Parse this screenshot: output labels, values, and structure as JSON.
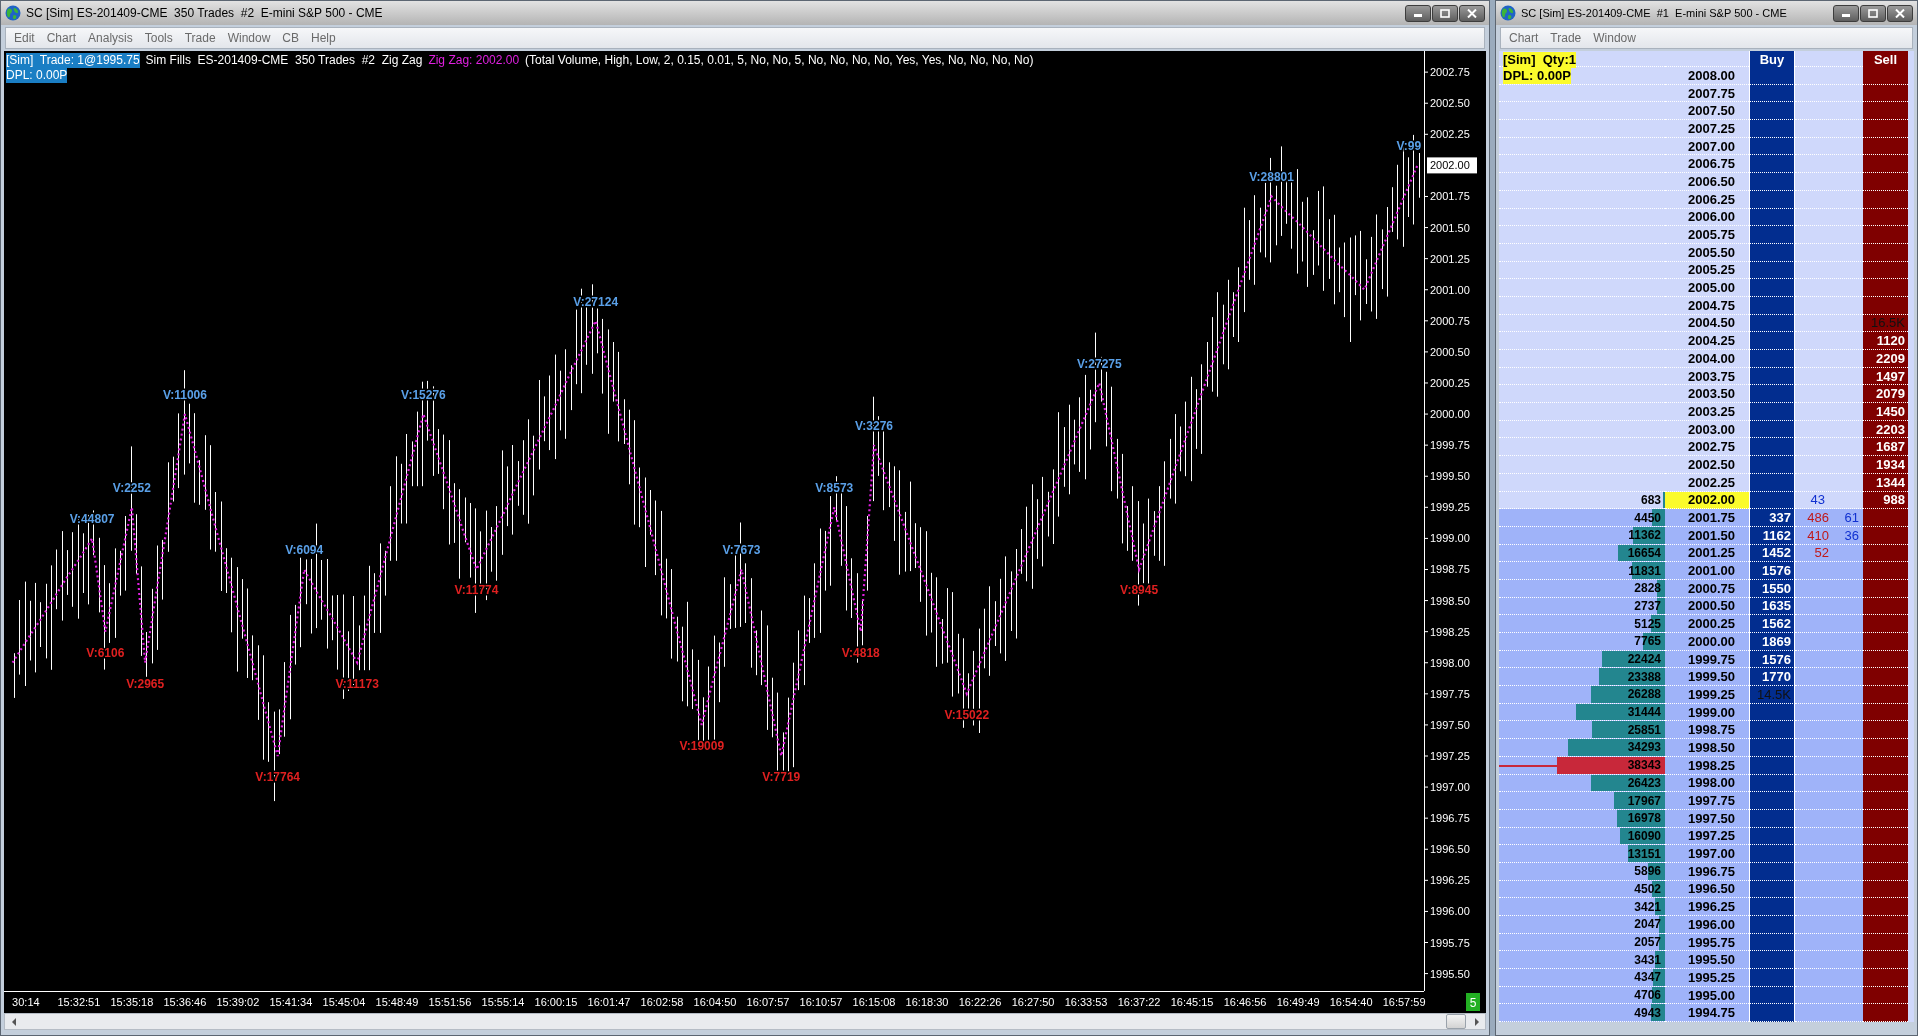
{
  "chart_window": {
    "title": "SC [Sim] ES-201409-CME  350 Trades  #2  E-mini S&P 500 - CME",
    "menu": [
      "Edit",
      "Chart",
      "Analysis",
      "Tools",
      "Trade",
      "Window",
      "CB",
      "Help"
    ],
    "chart": {
      "header": [
        {
          "text": "[Sim]  Trade: 1@1995.75",
          "kind": "badge"
        },
        {
          "text": "Sim Fills  ES-201409-CME  350 Trades  #2  Zig Zag",
          "kind": "plain"
        },
        {
          "text": "Zig Zag: 2002.00",
          "kind": "study"
        },
        {
          "text": "(Total Volume, High, Low, 2, 0.15, 0.01, 5, No, No, 5, No, No, No, No, Yes, Yes, No, No, No, No)",
          "kind": "plain"
        }
      ],
      "dpl": "DPL: 0.00P",
      "badge": "5",
      "last_price": "2002.00",
      "chart_data": {
        "type": "line",
        "ylim": [
          1995.36,
          2002.92
        ],
        "categories": [
          null,
          "30:14",
          null,
          null,
          null,
          "15:32:51",
          null,
          null,
          null,
          "15:35:18",
          null,
          null,
          null,
          "15:36:46",
          null,
          null,
          null,
          "15:39:02",
          null,
          null,
          null,
          "15:41:34",
          null,
          null,
          null,
          "15:45:04",
          null,
          null,
          null,
          "15:48:49",
          null,
          null,
          null,
          "15:51:56",
          null,
          null,
          null,
          "15:55:14",
          null,
          null,
          null,
          "16:00:15",
          null,
          null,
          null,
          "16:01:47",
          null,
          null,
          null,
          "16:02:58",
          null,
          null,
          null,
          "16:04:50",
          null,
          null,
          null,
          "16:07:57",
          null,
          null,
          null,
          "16:10:57",
          null,
          null,
          null,
          "16:15:08",
          null,
          null,
          null,
          "16:18:30",
          null,
          null,
          null,
          "16:22:26",
          null,
          null,
          null,
          "16:27:50",
          null,
          null,
          null,
          "16:33:53",
          null,
          null,
          null,
          "16:37:22",
          null,
          null,
          null,
          "16:45:15",
          null,
          null,
          null,
          "16:46:56",
          null,
          null,
          null,
          "16:49:49",
          null,
          null,
          null,
          "16:54:40",
          null,
          null,
          null,
          "16:57:59",
          null
        ],
        "series": [
          {
            "color": "#e020e0",
            "line_style": "dotted",
            "values": [
              1998.0,
              1998.17,
              1998.33,
              1998.5,
              1998.67,
              1998.83,
              1999.0,
              1998.25,
              1998.75,
              1999.25,
              1998.0,
              1998.67,
              1999.33,
              2000.0,
              1999.61,
              1999.21,
              1998.82,
              1998.43,
              1998.04,
              1997.64,
              1997.25,
              1998.0,
              1998.75,
              1998.56,
              1998.38,
              1998.19,
              1998.0,
              1998.4,
              1998.8,
              1999.2,
              1999.6,
              2000.0,
              1999.69,
              1999.38,
              1999.06,
              1998.75,
              1998.97,
              1999.19,
              1999.42,
              1999.64,
              1999.86,
              2000.08,
              2000.31,
              2000.53,
              2000.75,
              2000.34,
              1999.94,
              1999.53,
              1999.13,
              1998.72,
              1998.31,
              1997.91,
              1997.5,
              1997.92,
              1998.33,
              1998.75,
              1998.25,
              1997.75,
              1997.25,
              1997.75,
              1998.25,
              1998.75,
              1999.25,
              1998.75,
              1998.25,
              1999.75,
              1999.46,
              1999.18,
              1998.89,
              1998.61,
              1998.32,
              1998.04,
              1997.75,
              1998.0,
              1998.25,
              1998.5,
              1998.75,
              1999.0,
              1999.25,
              1999.5,
              1999.75,
              2000.0,
              2000.25,
              1999.75,
              1999.25,
              1998.75,
              1999.05,
              1999.35,
              1999.65,
              1999.95,
              2000.25,
              2000.55,
              2000.85,
              2001.15,
              2001.45,
              2001.75,
              2001.64,
              2001.54,
              2001.43,
              2001.32,
              2001.21,
              2001.11,
              2001.0,
              2001.25,
              2001.5,
              2001.75,
              2002.0
            ]
          }
        ],
        "yticks": [
          {
            "value": 2002.75,
            "label": "2002.75"
          },
          {
            "value": 2002.5,
            "label": "2002.50"
          },
          {
            "value": 2002.25,
            "label": "2002.25"
          },
          {
            "value": 2001.75,
            "label": "2001.75"
          },
          {
            "value": 2001.5,
            "label": "2001.50"
          },
          {
            "value": 2001.25,
            "label": "2001.25"
          },
          {
            "value": 2001.0,
            "label": "2001.00"
          },
          {
            "value": 2000.75,
            "label": "2000.75"
          },
          {
            "value": 2000.5,
            "label": "2000.50"
          },
          {
            "value": 2000.25,
            "label": "2000.25"
          },
          {
            "value": 2000.0,
            "label": "2000.00"
          },
          {
            "value": 1999.75,
            "label": "1999.75"
          },
          {
            "value": 1999.5,
            "label": "1999.50"
          },
          {
            "value": 1999.25,
            "label": "1999.25"
          },
          {
            "value": 1999.0,
            "label": "1999.00"
          },
          {
            "value": 1998.75,
            "label": "1998.75"
          },
          {
            "value": 1998.5,
            "label": "1998.50"
          },
          {
            "value": 1998.25,
            "label": "1998.25"
          },
          {
            "value": 1998.0,
            "label": "1998.00"
          },
          {
            "value": 1997.75,
            "label": "1997.75"
          },
          {
            "value": 1997.5,
            "label": "1997.50"
          },
          {
            "value": 1997.25,
            "label": "1997.25"
          },
          {
            "value": 1997.0,
            "label": "1997.00"
          },
          {
            "value": 1996.75,
            "label": "1996.75"
          },
          {
            "value": 1996.5,
            "label": "1996.50"
          },
          {
            "value": 1996.25,
            "label": "1996.25"
          },
          {
            "value": 1996.0,
            "label": "1996.00"
          },
          {
            "value": 1995.75,
            "label": "1995.75"
          },
          {
            "value": 1995.5,
            "label": "1995.50"
          }
        ],
        "annotations": [
          {
            "y": 1999.0,
            "text": "V:44807"
          },
          {
            "y": 1998.25,
            "text": "V:6106"
          },
          {
            "y": 1999.25,
            "text": "V:2252"
          },
          {
            "y": 1998.0,
            "text": "V:2965"
          },
          {
            "y": 2000.0,
            "text": "V:11006"
          },
          {
            "y": 1997.25,
            "text": "V:17764"
          },
          {
            "y": 1998.75,
            "text": "V:6094"
          },
          {
            "y": 1998.0,
            "text": "V:11173"
          },
          {
            "y": 2000.0,
            "text": "V:15276"
          },
          {
            "y": 1998.75,
            "text": "V:11774"
          },
          {
            "y": 2000.75,
            "text": "V:27124"
          },
          {
            "y": 1997.5,
            "text": "V:19009"
          },
          {
            "y": 1998.75,
            "text": "V:7673"
          },
          {
            "y": 1997.25,
            "text": "V:7719"
          },
          {
            "y": 1999.25,
            "text": "V:8573"
          },
          {
            "y": 1998.25,
            "text": "V:4818"
          },
          {
            "y": 1999.75,
            "text": "V:3276"
          },
          {
            "y": 1997.75,
            "text": "V:15022"
          },
          {
            "y": 2000.25,
            "text": "V:27275"
          },
          {
            "y": 1998.75,
            "text": "V:8945"
          },
          {
            "y": 2001.75,
            "text": "V:28801"
          },
          {
            "text": "V:99"
          }
        ]
      }
    }
  },
  "dom_window": {
    "title": "SC [Sim] ES-201409-CME  #1  E-mini S&P 500 - CME",
    "menu": [
      "Chart",
      "Trade",
      "Window"
    ],
    "dom": {
      "status": "[Sim]  Qty:1",
      "dpl": "DPL: 0.00P",
      "buy_header": "Buy",
      "sell_header": "Sell",
      "rows": [
        {
          "price": "2008.00",
          "kind": "ask",
          "current": false
        },
        {
          "price": "2007.75",
          "kind": "ask",
          "current": false
        },
        {
          "price": "2007.50",
          "kind": "ask",
          "current": false
        },
        {
          "price": "2007.25",
          "kind": "ask",
          "current": false
        },
        {
          "price": "2007.00",
          "kind": "ask",
          "current": false
        },
        {
          "price": "2006.75",
          "kind": "ask",
          "current": false
        },
        {
          "price": "2006.50",
          "kind": "ask",
          "current": false
        },
        {
          "price": "2006.25",
          "kind": "ask",
          "current": false
        },
        {
          "price": "2006.00",
          "kind": "ask",
          "current": false
        },
        {
          "price": "2005.75",
          "kind": "ask",
          "current": false
        },
        {
          "price": "2005.50",
          "kind": "ask",
          "current": false
        },
        {
          "price": "2005.25",
          "kind": "ask",
          "current": false
        },
        {
          "price": "2005.00",
          "kind": "ask",
          "current": false
        },
        {
          "price": "2004.75",
          "kind": "ask",
          "current": false
        },
        {
          "price": "2004.50",
          "kind": "ask",
          "current": false,
          "ask_total": "16.5K"
        },
        {
          "price": "2004.25",
          "kind": "ask",
          "current": false,
          "ask": "1120"
        },
        {
          "price": "2004.00",
          "kind": "ask",
          "current": false,
          "ask": "2209"
        },
        {
          "price": "2003.75",
          "kind": "ask",
          "current": false,
          "ask": "1497"
        },
        {
          "price": "2003.50",
          "kind": "ask",
          "current": false,
          "ask": "2079"
        },
        {
          "price": "2003.25",
          "kind": "ask",
          "current": false,
          "ask": "1450"
        },
        {
          "price": "2003.00",
          "kind": "ask",
          "current": false,
          "ask": "2203"
        },
        {
          "price": "2002.75",
          "kind": "ask",
          "current": false,
          "ask": "1687"
        },
        {
          "price": "2002.50",
          "kind": "ask",
          "current": false,
          "ask": "1934"
        },
        {
          "price": "2002.25",
          "kind": "ask",
          "current": false,
          "ask": "1344"
        },
        {
          "price": "2002.00",
          "kind": "ask",
          "current": true,
          "poc": false,
          "volume": "683",
          "recent_buy": "43",
          "ask": "988"
        },
        {
          "price": "2001.75",
          "kind": "bid",
          "current": false,
          "poc": false,
          "volume": "4450",
          "bid": "337",
          "recent_sell": "486",
          "recent_buy": "61"
        },
        {
          "price": "2001.50",
          "kind": "bid",
          "current": false,
          "poc": false,
          "volume": "11362",
          "bid": "1162",
          "recent_sell": "410",
          "recent_buy": "36"
        },
        {
          "price": "2001.25",
          "kind": "bid",
          "current": false,
          "poc": false,
          "volume": "16654",
          "bid": "1452",
          "recent_sell": "52"
        },
        {
          "price": "2001.00",
          "kind": "bid",
          "current": false,
          "poc": false,
          "volume": "11831",
          "bid": "1576"
        },
        {
          "price": "2000.75",
          "kind": "bid",
          "current": false,
          "poc": false,
          "volume": "2828",
          "bid": "1550"
        },
        {
          "price": "2000.50",
          "kind": "bid",
          "current": false,
          "poc": false,
          "volume": "2737",
          "bid": "1635"
        },
        {
          "price": "2000.25",
          "kind": "bid",
          "current": false,
          "poc": false,
          "volume": "5125",
          "bid": "1562"
        },
        {
          "price": "2000.00",
          "kind": "bid",
          "current": false,
          "poc": false,
          "volume": "7765",
          "bid": "1869"
        },
        {
          "price": "1999.75",
          "kind": "bid",
          "current": false,
          "poc": false,
          "volume": "22424",
          "bid": "1576"
        },
        {
          "price": "1999.50",
          "kind": "bid",
          "current": false,
          "poc": false,
          "volume": "23388",
          "bid": "1770"
        },
        {
          "price": "1999.25",
          "kind": "bid",
          "current": false,
          "poc": false,
          "volume": "26288",
          "bid_total": "14.5K"
        },
        {
          "price": "1999.00",
          "kind": "bid",
          "current": false,
          "poc": false,
          "volume": "31444"
        },
        {
          "price": "1998.75",
          "kind": "bid",
          "current": false,
          "poc": false,
          "volume": "25851"
        },
        {
          "price": "1998.50",
          "kind": "bid",
          "current": false,
          "poc": false,
          "volume": "34293"
        },
        {
          "price": "1998.25",
          "kind": "bid",
          "current": false,
          "poc": true,
          "volume": "38343"
        },
        {
          "price": "1998.00",
          "kind": "bid",
          "current": false,
          "poc": false,
          "volume": "26423"
        },
        {
          "price": "1997.75",
          "kind": "bid",
          "current": false,
          "poc": false,
          "volume": "17967"
        },
        {
          "price": "1997.50",
          "kind": "bid",
          "current": false,
          "poc": false,
          "volume": "16978"
        },
        {
          "price": "1997.25",
          "kind": "bid",
          "current": false,
          "poc": false,
          "volume": "16090"
        },
        {
          "price": "1997.00",
          "kind": "bid",
          "current": false,
          "poc": false,
          "volume": "13151"
        },
        {
          "price": "1996.75",
          "kind": "bid",
          "current": false,
          "poc": false,
          "volume": "5896"
        },
        {
          "price": "1996.50",
          "kind": "bid",
          "current": false,
          "poc": false,
          "volume": "4502"
        },
        {
          "price": "1996.25",
          "kind": "bid",
          "current": false,
          "poc": false,
          "volume": "3421"
        },
        {
          "price": "1996.00",
          "kind": "bid",
          "current": false,
          "poc": false,
          "volume": "2047"
        },
        {
          "price": "1995.75",
          "kind": "bid",
          "current": false,
          "poc": false,
          "volume": "2057"
        },
        {
          "price": "1995.50",
          "kind": "bid",
          "current": false,
          "poc": false,
          "volume": "3431"
        },
        {
          "price": "1995.25",
          "kind": "bid",
          "current": false,
          "poc": false,
          "volume": "4347"
        },
        {
          "price": "1995.00",
          "kind": "bid",
          "current": false,
          "poc": false,
          "volume": "4706"
        },
        {
          "price": "1994.75",
          "kind": "bid",
          "current": false,
          "poc": false,
          "volume": "4943"
        }
      ]
    }
  }
}
